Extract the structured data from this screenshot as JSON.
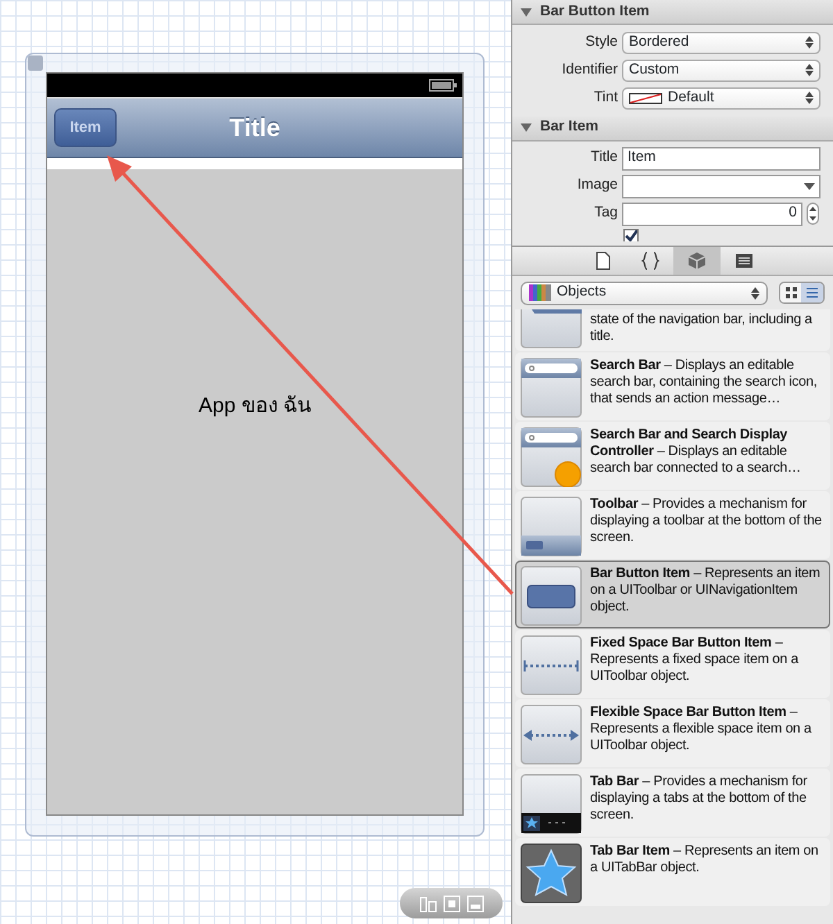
{
  "canvas": {
    "status_bar": {
      "battery": true
    },
    "nav_bar": {
      "button_label": "Item",
      "title": "Title"
    },
    "content_label": "App ของ ฉัน"
  },
  "inspector": {
    "sections": [
      {
        "title": "Bar Button Item",
        "expanded": true,
        "fields": [
          {
            "label": "Style",
            "kind": "select",
            "value": "Bordered"
          },
          {
            "label": "Identifier",
            "kind": "select",
            "value": "Custom"
          },
          {
            "label": "Tint",
            "kind": "color",
            "value": "Default"
          }
        ]
      },
      {
        "title": "Bar Item",
        "expanded": true,
        "fields": [
          {
            "label": "Title",
            "kind": "text",
            "value": "Item"
          },
          {
            "label": "Image",
            "kind": "combo"
          },
          {
            "label": "Tag",
            "kind": "stepper",
            "value": "0"
          },
          {
            "kind": "checkbox",
            "checked": true
          }
        ]
      }
    ]
  },
  "library": {
    "tabs": [
      {
        "kind": "file",
        "selected": false
      },
      {
        "kind": "braces",
        "selected": false
      },
      {
        "kind": "cube",
        "selected": true
      },
      {
        "kind": "media",
        "selected": false
      }
    ],
    "filter": "Objects",
    "views": [
      {
        "kind": "grid",
        "selected": false
      },
      {
        "kind": "list",
        "selected": true
      }
    ],
    "items": [
      {
        "kind": "navbar",
        "text": "state of the navigation bar, including a title.",
        "selected": false
      },
      {
        "kind": "searchbar",
        "text": "**Search Bar** – Displays an editable search bar, containing the search icon, that sends an action message…",
        "selected": false
      },
      {
        "kind": "searchdisplay",
        "text": "**Search Bar and Search Display Controller** – Displays an editable search bar connected to a search…",
        "selected": false
      },
      {
        "kind": "toolbar",
        "text": "**Toolbar** – Provides a mechanism for displaying a toolbar at the bottom of the screen.",
        "selected": false
      },
      {
        "kind": "barbutton",
        "text": "**Bar Button Item** – Represents an item on a UIToolbar or UINavigationItem object.",
        "selected": true
      },
      {
        "kind": "fixedspace",
        "text": "**Fixed Space Bar Button Item** – Represents a fixed space item on a UIToolbar object.",
        "selected": false
      },
      {
        "kind": "flexiblespace",
        "text": "**Flexible Space Bar Button Item** – Represents a flexible space item on a UIToolbar object.",
        "selected": false
      },
      {
        "kind": "tabbar",
        "text": "**Tab Bar** – Provides a mechanism for displaying a tabs at the bottom of the screen.",
        "selected": false
      },
      {
        "kind": "tabbaritem",
        "text": "**Tab Bar Item** – Represents an item on a UITabBar object.",
        "selected": false
      }
    ]
  }
}
